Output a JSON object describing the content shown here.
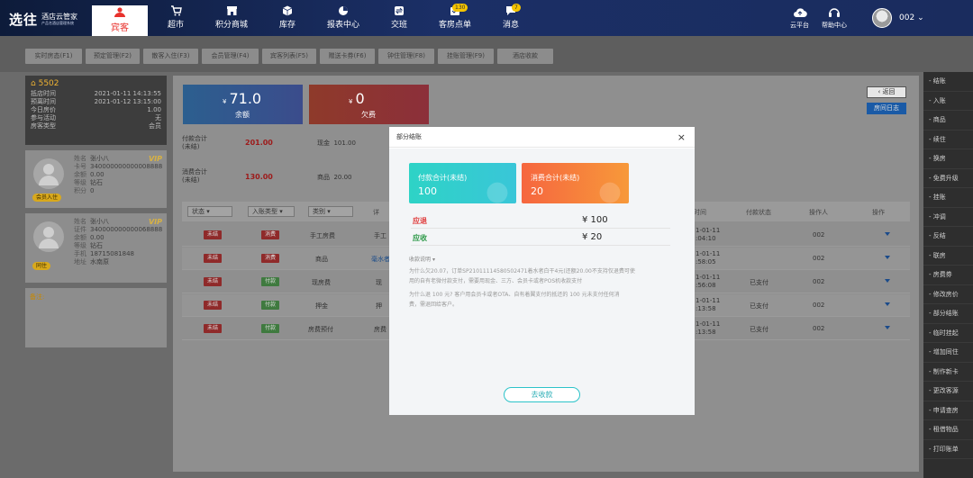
{
  "topbar": {
    "logo_main": "选往",
    "logo_sub": "酒店云管家",
    "logo_tagline": "产品名酒店管理系统",
    "nav": [
      {
        "label": "宾客",
        "icon": "guest-icon",
        "active": true
      },
      {
        "label": "超市",
        "icon": "cart-icon"
      },
      {
        "label": "积分商城",
        "icon": "store-icon"
      },
      {
        "label": "库存",
        "icon": "box-icon"
      },
      {
        "label": "报表中心",
        "icon": "pie-chart-icon"
      },
      {
        "label": "交班",
        "icon": "handover-icon"
      },
      {
        "label": "客房点单",
        "icon": "order-icon",
        "badge": "130"
      },
      {
        "label": "消息",
        "icon": "message-icon",
        "badge": "7"
      }
    ],
    "cloud_label": "云平台",
    "help_label": "帮助中心",
    "user": "002"
  },
  "tabs": [
    "实时房态(F1)",
    "预定管理(F2)",
    "散客入住(F3)",
    "会员管理(F4)",
    "宾客列表(F5)",
    "赠送卡券(F6)",
    "钟住管理(F8)",
    "挂账管理(F9)",
    "酒店收款"
  ],
  "room": {
    "number": "5502",
    "rows": [
      {
        "k": "抵店时间",
        "v": "2021-01-11 14:13:55"
      },
      {
        "k": "预离时间",
        "v": "2021-01-12 13:15:00"
      },
      {
        "k": "今日房价",
        "v": "1.00"
      },
      {
        "k": "参与活动",
        "v": "无"
      },
      {
        "k": "房客类型",
        "v": "会员"
      }
    ]
  },
  "guests": [
    {
      "tag": "会员入住",
      "vip": "VIP",
      "rows": [
        {
          "k": "姓名",
          "v": "张小八"
        },
        {
          "k": "卡号",
          "v": "340000000000008888"
        },
        {
          "k": "余额",
          "v": "0.00"
        },
        {
          "k": "等级",
          "v": "钻石"
        },
        {
          "k": "积分",
          "v": "0"
        }
      ]
    },
    {
      "tag": "同住",
      "vip": "VIP",
      "rows": [
        {
          "k": "姓名",
          "v": "张小八"
        },
        {
          "k": "证件",
          "v": "340000000000068888"
        },
        {
          "k": "余额",
          "v": "0.00"
        },
        {
          "k": "等级",
          "v": "钻石"
        },
        {
          "k": "手机",
          "v": "18715081848"
        },
        {
          "k": "地址",
          "v": "水南原"
        }
      ]
    }
  ],
  "note_label": "备注:",
  "summary": {
    "balance_value": "71.0",
    "balance_label": "余额",
    "debt_value": "0",
    "debt_label": "欠费",
    "currency": "¥",
    "pay_total_label": "付款合计\n(未结)",
    "pay_total_value": "201.00",
    "consume_total_label": "消费合计\n(未结)",
    "consume_total_value": "130.00",
    "cash_label": "现金",
    "cash_value": "101.00",
    "goods_label": "商品",
    "goods_value": "20.00"
  },
  "back_label": "返回",
  "room_log_label": "房间日志",
  "table": {
    "filters": [
      "状态",
      "入账类型",
      "类别"
    ],
    "headers": {
      "detail": "详",
      "time": "时间",
      "pay_status": "付款状态",
      "operator": "操作人",
      "action": "操作"
    },
    "rows": [
      {
        "status": "未结",
        "type": "消费",
        "category": "手工房费",
        "detail": "手工",
        "time1": "1-01-11",
        "time2": ":04:10",
        "pay": "",
        "op": "002"
      },
      {
        "status": "未结",
        "type": "消费",
        "category": "商品",
        "detail": "毫水者",
        "time1": "1-01-11",
        "time2": ":58:05",
        "pay": "",
        "op": "002"
      },
      {
        "status": "未结",
        "type": "付款",
        "category": "现房费",
        "detail": "现",
        "time1": "1-01-11",
        "time2": ":56:08",
        "pay": "已支付",
        "op": "002"
      },
      {
        "status": "未结",
        "type": "付款",
        "category": "押金",
        "detail": "押",
        "time1": "1-01-11",
        "time2": ":13:58",
        "pay": "已支付",
        "op": "002"
      },
      {
        "status": "未结",
        "type": "付款",
        "category": "房费预付",
        "detail": "房费",
        "time1": "1-01-11",
        "time2": ":13:58",
        "pay": "已支付",
        "op": "002"
      }
    ]
  },
  "sidebar": [
    "结账",
    "入账",
    "商品",
    "续住",
    "换房",
    "免费升级",
    "挂账",
    "冲调",
    "反结",
    "联房",
    "房费券",
    "修改房价",
    "部分结账",
    "临时挂起",
    "增加同住",
    "制作新卡",
    "更改客源",
    "申请查房",
    "租借物品",
    "打印账单"
  ],
  "modal": {
    "title": "部分结账",
    "pay_card_label": "付款合计(未结)",
    "pay_card_value": "100",
    "consume_card_label": "消费合计(未结)",
    "consume_card_value": "20",
    "refund_label": "应退",
    "refund_value": "¥ 100",
    "receivable_label": "应收",
    "receivable_value": "¥ 20",
    "note_title": "收款说明",
    "note_lines": [
      "为什么欠20.07，订单SP21011114580502471着水者白干4元(还额20.00不支持仅退费可使",
      "用的自有老微付款支付，需要用现金、三方、会员卡或者POS机收款支付",
      "为什么退 100 元? 客户用会员卡或者OTA、自有着翼支付的抵还的 100 元未支付任何消",
      "费，需退回给客户。"
    ],
    "pay_button": "去收款"
  },
  "colors": {
    "pay_card": "#2ed3c6",
    "consume_card": "#f6663f",
    "refund_label": "#e04040",
    "receivable_label": "#2f9a4a"
  }
}
